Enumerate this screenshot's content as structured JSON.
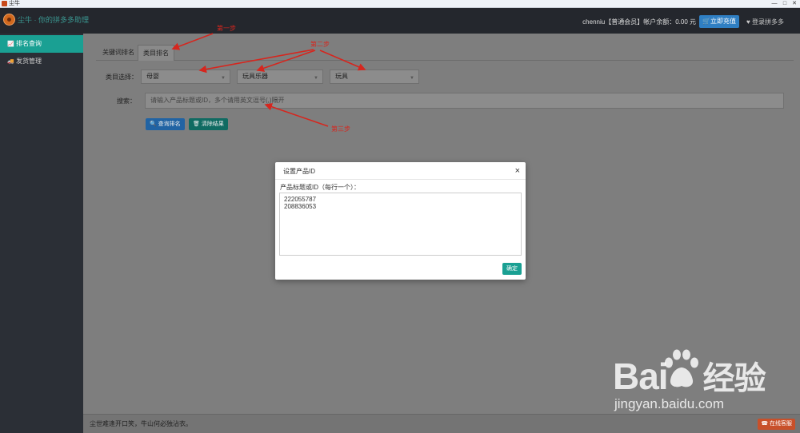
{
  "titlebar": {
    "title": "尘牛",
    "min": "—",
    "max": "□",
    "close": "✕"
  },
  "header": {
    "brand": "尘牛 · 你的拼多多助理",
    "user_info": "chenniu【普通会员】帐户余额：0.00 元",
    "recharge_label": "立即充值",
    "login_label": "登录拼多多"
  },
  "sidebar": {
    "items": [
      {
        "label": "排名查询",
        "icon": "chart-icon",
        "active": true
      },
      {
        "label": "发货管理",
        "icon": "truck-icon",
        "active": false
      }
    ]
  },
  "tabs": [
    {
      "label": "关键词排名",
      "active": false
    },
    {
      "label": "类目排名",
      "active": true
    }
  ],
  "category": {
    "label": "类目选择：",
    "selects": [
      "母婴",
      "玩具乐器",
      "玩具"
    ]
  },
  "search": {
    "label": "搜索：",
    "placeholder": "请输入产品标题或ID，多个请用英文逗号(,)隔开"
  },
  "buttons": {
    "query": "查询排名",
    "clear": "清除结果"
  },
  "annotations": {
    "step1": "第一步",
    "step2": "第二步",
    "step3": "第三步"
  },
  "footer": {
    "text": "尘世难逢开口笑，牛山何必独沾衣。",
    "chat": "在线客服"
  },
  "modal": {
    "title": "设置产品ID",
    "field_label": "产品标题或ID（每行一个）：",
    "textarea_value": "222055787\n208836053",
    "confirm": "确定"
  },
  "watermark": {
    "logo": "Bai",
    "logo_suffix": "经验",
    "url": "jingyan.baidu.com"
  },
  "colors": {
    "accent": "#1aa093",
    "header_bg": "#24272d",
    "annotation": "#d6261e",
    "primary_button": "#2f7fc3"
  }
}
